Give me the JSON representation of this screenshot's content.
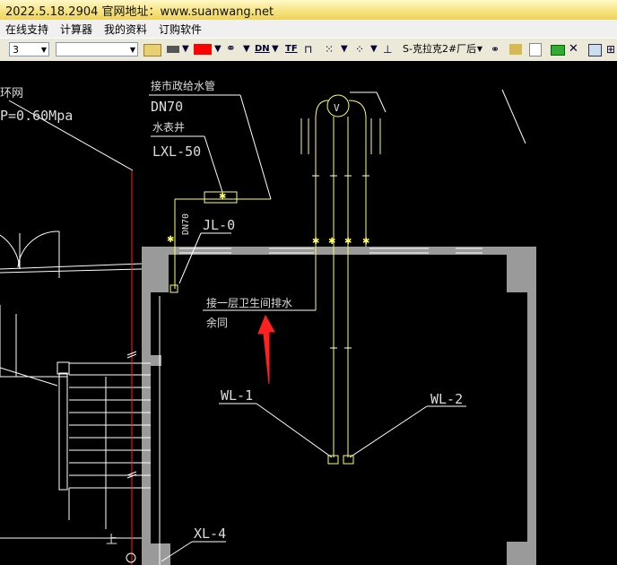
{
  "title": "2022.5.18.2904 官网地址：www.suanwang.net",
  "menu": [
    "在线支持",
    "计算器",
    "我的资料",
    "订购软件"
  ],
  "toolbar": {
    "layer_value": "3",
    "color_hex": "#ff0000",
    "dn_label": "DN",
    "tf_label": "TF",
    "style_value": "S-克拉克2#厂后"
  },
  "drawing": {
    "ring_label": "环网",
    "pressure": "P=0.60Mpa",
    "connect_label": "接市政给水管",
    "dn70_top": "DN70",
    "well_label": "水表井",
    "lxl": "LXL-50",
    "dn70_vert": "DN70",
    "jl": "JL-0",
    "drain_note_1": "接一层卫生间排水",
    "drain_note_2": "余同",
    "wl1": "WL-1",
    "wl2": "WL-2",
    "xl4": "XL-4",
    "up_label": "上",
    "v_label": "V",
    "colors": {
      "background": "#000000",
      "lines": "#ffffff",
      "pipes": "#ffff66",
      "walls": "#9a9a9a",
      "red": "#ff2020"
    }
  }
}
